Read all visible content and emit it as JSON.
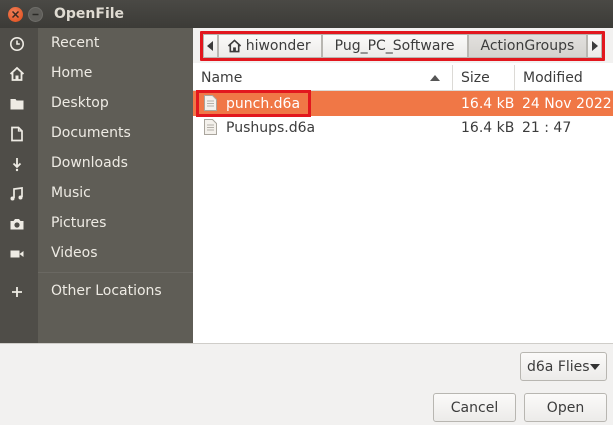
{
  "window": {
    "title": "OpenFile"
  },
  "sidebar": {
    "items": [
      {
        "label": "Recent",
        "icon": "clock-icon"
      },
      {
        "label": "Home",
        "icon": "home-icon"
      },
      {
        "label": "Desktop",
        "icon": "folder-icon"
      },
      {
        "label": "Documents",
        "icon": "document-icon"
      },
      {
        "label": "Downloads",
        "icon": "download-icon"
      },
      {
        "label": "Music",
        "icon": "music-icon"
      },
      {
        "label": "Pictures",
        "icon": "camera-icon"
      },
      {
        "label": "Videos",
        "icon": "video-icon"
      },
      {
        "label": "Other Locations",
        "icon": "plus-icon"
      }
    ]
  },
  "pathbar": {
    "home_label": "hiwonder",
    "segments": [
      "Pug_PC_Software",
      "ActionGroups"
    ],
    "active_segment": "ActionGroups"
  },
  "columns": {
    "name": "Name",
    "size": "Size",
    "modified": "Modified"
  },
  "files": [
    {
      "name": "punch.d6a",
      "size": "16.4 kB",
      "modified": "24 Nov 2022",
      "selected": true
    },
    {
      "name": "Pushups.d6a",
      "size": "16.4 kB",
      "modified": "21 : 47",
      "selected": false
    }
  ],
  "filter": {
    "selected": "d6a Flies"
  },
  "buttons": {
    "cancel": "Cancel",
    "open": "Open"
  },
  "colors": {
    "selection": "#f07746",
    "highlight_frame": "#e2171e",
    "sidebar": "#5f5d56"
  }
}
